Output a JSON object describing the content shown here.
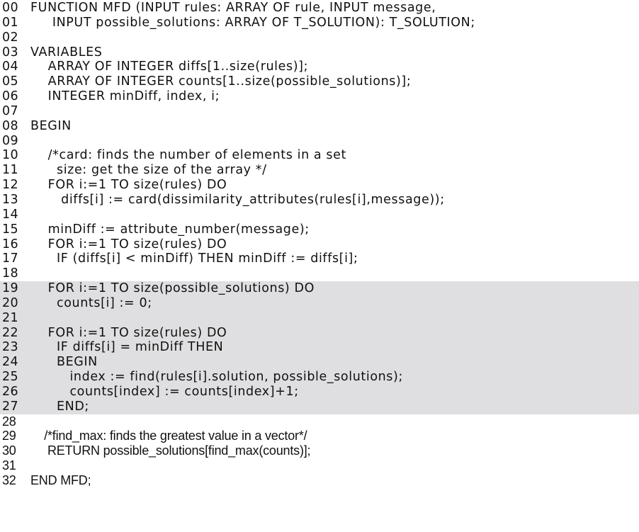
{
  "listing": {
    "title": "FUNCTION MFD",
    "highlight_color": "#dfdfe1",
    "highlighted_lines": [
      "19",
      "27"
    ],
    "lines": [
      {
        "num": "00",
        "text": "FUNCTION MFD (INPUT rules: ARRAY OF rule, INPUT message,"
      },
      {
        "num": "01",
        "text": "     INPUT possible_solutions: ARRAY OF T_SOLUTION): T_SOLUTION;"
      },
      {
        "num": "02",
        "text": ""
      },
      {
        "num": "03",
        "text": "VARIABLES"
      },
      {
        "num": "04",
        "text": "    ARRAY OF INTEGER diffs[1..size(rules)];"
      },
      {
        "num": "05",
        "text": "    ARRAY OF INTEGER counts[1..size(possible_solutions)];"
      },
      {
        "num": "06",
        "text": "    INTEGER minDiff, index, i;"
      },
      {
        "num": "07",
        "text": ""
      },
      {
        "num": "08",
        "text": "BEGIN"
      },
      {
        "num": "09",
        "text": ""
      },
      {
        "num": "10",
        "text": "    /*card: finds the number of elements in a set"
      },
      {
        "num": "11",
        "text": "      size: get the size of the array */"
      },
      {
        "num": "12",
        "text": "    FOR i:=1 TO size(rules) DO"
      },
      {
        "num": "13",
        "text": "       diffs[i] := card(dissimilarity_attributes(rules[i],message));"
      },
      {
        "num": "14",
        "text": ""
      },
      {
        "num": "15",
        "text": "    minDiff := attribute_number(message);"
      },
      {
        "num": "16",
        "text": "    FOR i:=1 TO size(rules) DO"
      },
      {
        "num": "17",
        "text": "      IF (diffs[i] < minDiff) THEN minDiff := diffs[i];"
      },
      {
        "num": "18",
        "text": ""
      },
      {
        "num": "19",
        "text": "    FOR i:=1 TO size(possible_solutions) DO"
      },
      {
        "num": "20",
        "text": "      counts[i] := 0;"
      },
      {
        "num": "21",
        "text": ""
      },
      {
        "num": "22",
        "text": "    FOR i:=1 TO size(rules) DO"
      },
      {
        "num": "23",
        "text": "      IF diffs[i] = minDiff THEN"
      },
      {
        "num": "24",
        "text": "      BEGIN"
      },
      {
        "num": "25",
        "text": "         index := find(rules[i].solution, possible_solutions);"
      },
      {
        "num": "26",
        "text": "         counts[index] := counts[index]+1;"
      },
      {
        "num": "27",
        "text": "      END;"
      },
      {
        "num": "28",
        "text": ""
      },
      {
        "num": "29",
        "text": "    /*find_max: finds the greatest value in a vector*/"
      },
      {
        "num": "30",
        "text": "     RETURN possible_solutions[find_max(counts)];"
      },
      {
        "num": "31",
        "text": ""
      },
      {
        "num": "32",
        "text": "END MFD;"
      }
    ]
  }
}
